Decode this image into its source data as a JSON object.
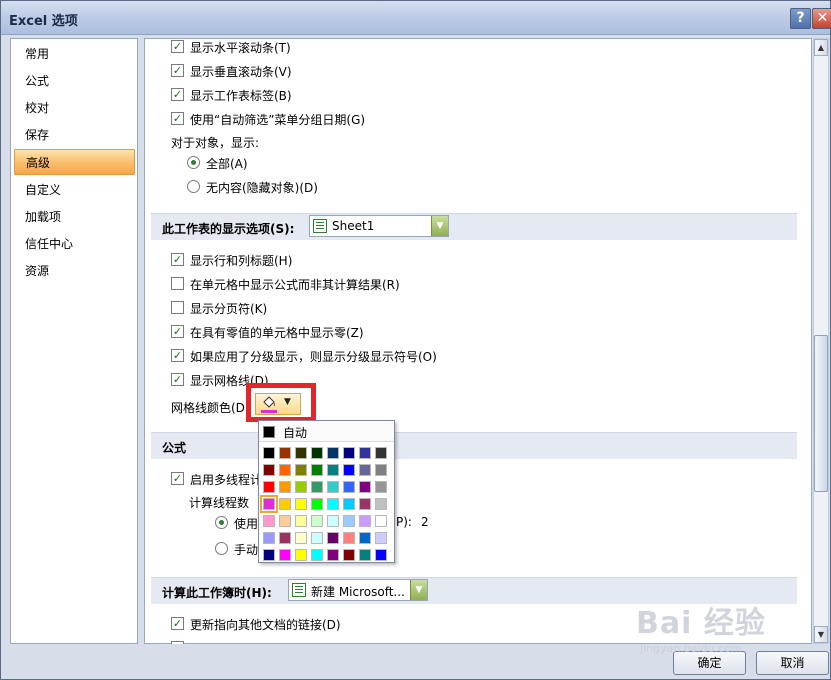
{
  "window": {
    "title": "Excel 选项",
    "help": "?",
    "close": "✕"
  },
  "nav": {
    "items": [
      "常用",
      "公式",
      "校对",
      "保存",
      "高级",
      "自定义",
      "加载项",
      "信任中心",
      "资源"
    ],
    "active_index": 4
  },
  "options": {
    "show_hscroll": {
      "label": "显示水平滚动条(T)",
      "checked": true
    },
    "show_vscroll": {
      "label": "显示垂直滚动条(V)",
      "checked": true
    },
    "show_tabs": {
      "label": "显示工作表标签(B)",
      "checked": true
    },
    "group_dates": {
      "label": "使用“自动筛选”菜单分组日期(G)",
      "checked": true
    },
    "objects_heading": "对于对象，显示:",
    "objects_all": {
      "label": "全部(A)",
      "selected": true
    },
    "objects_none": {
      "label": "无内容(隐藏对象)(D)",
      "selected": false
    }
  },
  "sheet_section": {
    "heading": "此工作表的显示选项(S):",
    "sheet_value": "Sheet1",
    "show_headers": {
      "label": "显示行和列标题(H)",
      "checked": true
    },
    "show_formulas": {
      "label": "在单元格中显示公式而非其计算结果(R)",
      "checked": false
    },
    "show_pagebreaks": {
      "label": "显示分页符(K)",
      "checked": false
    },
    "show_zero": {
      "label": "在具有零值的单元格中显示零(Z)",
      "checked": true
    },
    "show_outline": {
      "label": "如果应用了分级显示，则显示分级显示符号(O)",
      "checked": true
    },
    "show_gridlines": {
      "label": "显示网格线(D)",
      "checked": true
    },
    "gridline_color_label": "网格线颜色(D)"
  },
  "formula_section": {
    "heading": "公式",
    "multithread": {
      "label": "启用多线程计",
      "checked": true
    },
    "threads_label": "计算线程数",
    "use_all": {
      "label": "使用",
      "selected": true
    },
    "thread_suffix": "P):",
    "thread_count": "2",
    "manual": {
      "label": "手动",
      "selected": false
    }
  },
  "calc_section": {
    "heading": "计算此工作簿时(H):",
    "workbook_value": "新建 Microsoft...",
    "update_links": {
      "label": "更新指向其他文档的链接(D)",
      "checked": true
    }
  },
  "palette": {
    "auto_label": "自动",
    "selected_color": "#e02bd9",
    "rows": [
      [
        "#000000",
        "#993300",
        "#333300",
        "#003300",
        "#003366",
        "#000080",
        "#333399",
        "#333333"
      ],
      [
        "#800000",
        "#ff6600",
        "#808000",
        "#008000",
        "#008080",
        "#0000ff",
        "#666699",
        "#808080"
      ],
      [
        "#ff0000",
        "#ff9900",
        "#99cc00",
        "#339966",
        "#33cccc",
        "#3366ff",
        "#800080",
        "#969696"
      ],
      [
        "#ff00ff",
        "#ffcc00",
        "#ffff00",
        "#00ff00",
        "#00ffff",
        "#00ccff",
        "#993366",
        "#c0c0c0"
      ],
      [
        "#ff99cc",
        "#ffcc99",
        "#ffff99",
        "#ccffcc",
        "#ccffff",
        "#99ccff",
        "#cc99ff",
        "#ffffff"
      ],
      [
        "#9999ff",
        "#993366",
        "#ffffcc",
        "#ccffff",
        "#660066",
        "#ff8080",
        "#0066cc",
        "#ccccff"
      ],
      [
        "#000080",
        "#ff00ff",
        "#ffff00",
        "#00ffff",
        "#800080",
        "#800000",
        "#008080",
        "#0000ff"
      ]
    ]
  },
  "buttons": {
    "ok": "确定",
    "cancel": "取消"
  },
  "watermark": {
    "text": "Bai 经验",
    "url": "jingyan.baidu.com"
  }
}
